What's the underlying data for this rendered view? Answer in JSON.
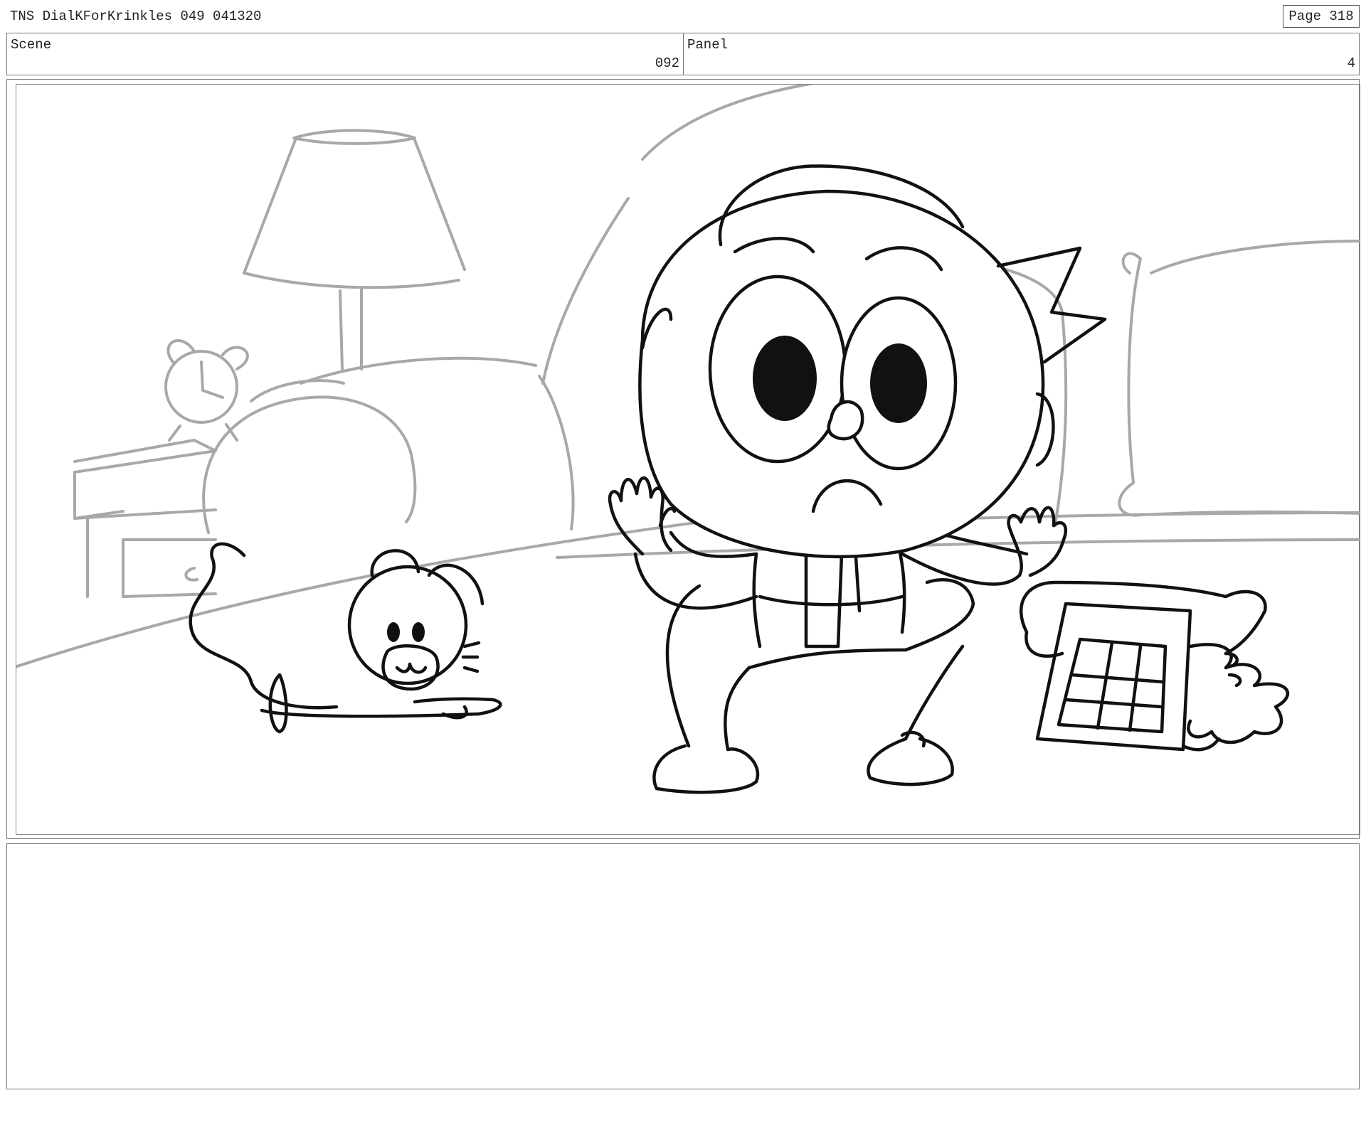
{
  "header": {
    "doc_title": "TNS DialKForKrinkles 049 041320",
    "page_label": "Page 318"
  },
  "scene": {
    "label": "Scene",
    "value": "092"
  },
  "panel": {
    "label": "Panel",
    "value": "4"
  },
  "frame": {
    "illustration": "storyboard-sketch",
    "elements": [
      "lamp-icon",
      "alarm-clock-icon",
      "nightstand-icon",
      "bed-icon",
      "pillow-icon",
      "mouse-toy-icon",
      "child-character-icon",
      "telephone-icon"
    ]
  },
  "notes": {
    "text": ""
  }
}
